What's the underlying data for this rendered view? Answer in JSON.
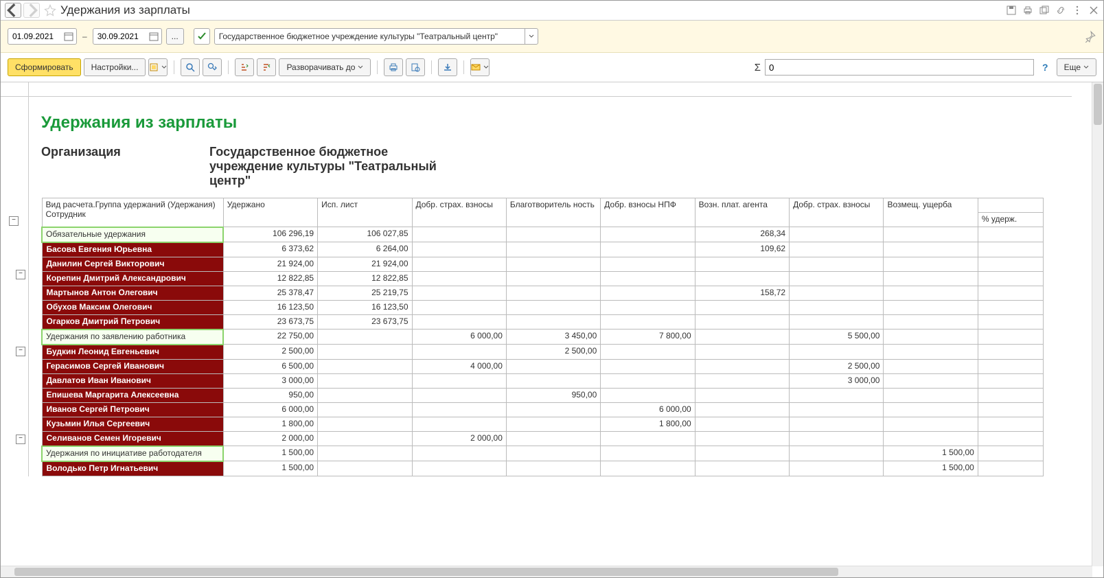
{
  "titlebar": {
    "title": "Удержания из зарплаты"
  },
  "params": {
    "date_from": "01.09.2021",
    "date_to": "30.09.2021",
    "org": "Государственное бюджетное учреждение культуры \"Театральный центр\""
  },
  "toolbar": {
    "run": "Сформировать",
    "settings": "Настройки...",
    "expand": "Разворачивать до",
    "more": "Еще"
  },
  "sum": {
    "value": "0",
    "sigma": "Σ"
  },
  "report": {
    "title": "Удержания из зарплаты",
    "org_label": "Организация",
    "org_value": "Государственное бюджетное учреждение культуры \"Театральный центр\"",
    "head1": "Вид расчета.Группа удержаний (Удержания)",
    "head1b": "Сотрудник",
    "cols": [
      "Удержано",
      "Исп. лист",
      "Добр. страх. взносы",
      "Благотворитель ность",
      "Добр. взносы НПФ",
      "Возн. плат. агента",
      "Добр. страх. взносы",
      "Возмещ. ущерба",
      "% удерж."
    ]
  },
  "groups": [
    {
      "name": "Обязательные удержания",
      "vals": [
        "106 296,19",
        "106 027,85",
        "",
        "",
        "",
        "268,34",
        "",
        "",
        ""
      ],
      "rows": [
        {
          "n": "Басова Евгения Юрьевна",
          "v": [
            "6 373,62",
            "6 264,00",
            "",
            "",
            "",
            "109,62",
            "",
            "",
            ""
          ]
        },
        {
          "n": "Данилин Сергей Викторович",
          "v": [
            "21 924,00",
            "21 924,00",
            "",
            "",
            "",
            "",
            "",
            "",
            ""
          ]
        },
        {
          "n": "Корепин Дмитрий Александрович",
          "v": [
            "12 822,85",
            "12 822,85",
            "",
            "",
            "",
            "",
            "",
            "",
            ""
          ]
        },
        {
          "n": "Мартынов Антон Олегович",
          "v": [
            "25 378,47",
            "25 219,75",
            "",
            "",
            "",
            "158,72",
            "",
            "",
            ""
          ]
        },
        {
          "n": "Обухов Максим Олегович",
          "v": [
            "16 123,50",
            "16 123,50",
            "",
            "",
            "",
            "",
            "",
            "",
            ""
          ]
        },
        {
          "n": "Огарков Дмитрий Петрович",
          "v": [
            "23 673,75",
            "23 673,75",
            "",
            "",
            "",
            "",
            "",
            "",
            ""
          ]
        }
      ]
    },
    {
      "name": "Удержания по заявлению работника",
      "vals": [
        "22 750,00",
        "",
        "6 000,00",
        "3 450,00",
        "7 800,00",
        "",
        "5 500,00",
        "",
        ""
      ],
      "rows": [
        {
          "n": "Будкин Леонид Евгеньевич",
          "v": [
            "2 500,00",
            "",
            "",
            "2 500,00",
            "",
            "",
            "",
            "",
            ""
          ]
        },
        {
          "n": "Герасимов Сергей Иванович",
          "v": [
            "6 500,00",
            "",
            "4 000,00",
            "",
            "",
            "",
            "2 500,00",
            "",
            ""
          ]
        },
        {
          "n": "Давлатов Иван Иванович",
          "v": [
            "3 000,00",
            "",
            "",
            "",
            "",
            "",
            "3 000,00",
            "",
            ""
          ]
        },
        {
          "n": "Епишева Маргарита Алексеевна",
          "v": [
            "950,00",
            "",
            "",
            "950,00",
            "",
            "",
            "",
            "",
            ""
          ]
        },
        {
          "n": "Иванов Сергей Петрович",
          "v": [
            "6 000,00",
            "",
            "",
            "",
            "6 000,00",
            "",
            "",
            "",
            ""
          ]
        },
        {
          "n": "Кузьмин Илья Сергеевич",
          "v": [
            "1 800,00",
            "",
            "",
            "",
            "1 800,00",
            "",
            "",
            "",
            ""
          ]
        },
        {
          "n": "Селиванов Семен Игоревич",
          "v": [
            "2 000,00",
            "",
            "2 000,00",
            "",
            "",
            "",
            "",
            "",
            ""
          ]
        }
      ]
    },
    {
      "name": "Удержания по инициативе работодателя",
      "vals": [
        "1 500,00",
        "",
        "",
        "",
        "",
        "",
        "",
        "1 500,00",
        ""
      ],
      "rows": [
        {
          "n": "Володько Петр Игнатьевич",
          "v": [
            "1 500,00",
            "",
            "",
            "",
            "",
            "",
            "",
            "1 500,00",
            ""
          ]
        }
      ]
    }
  ]
}
